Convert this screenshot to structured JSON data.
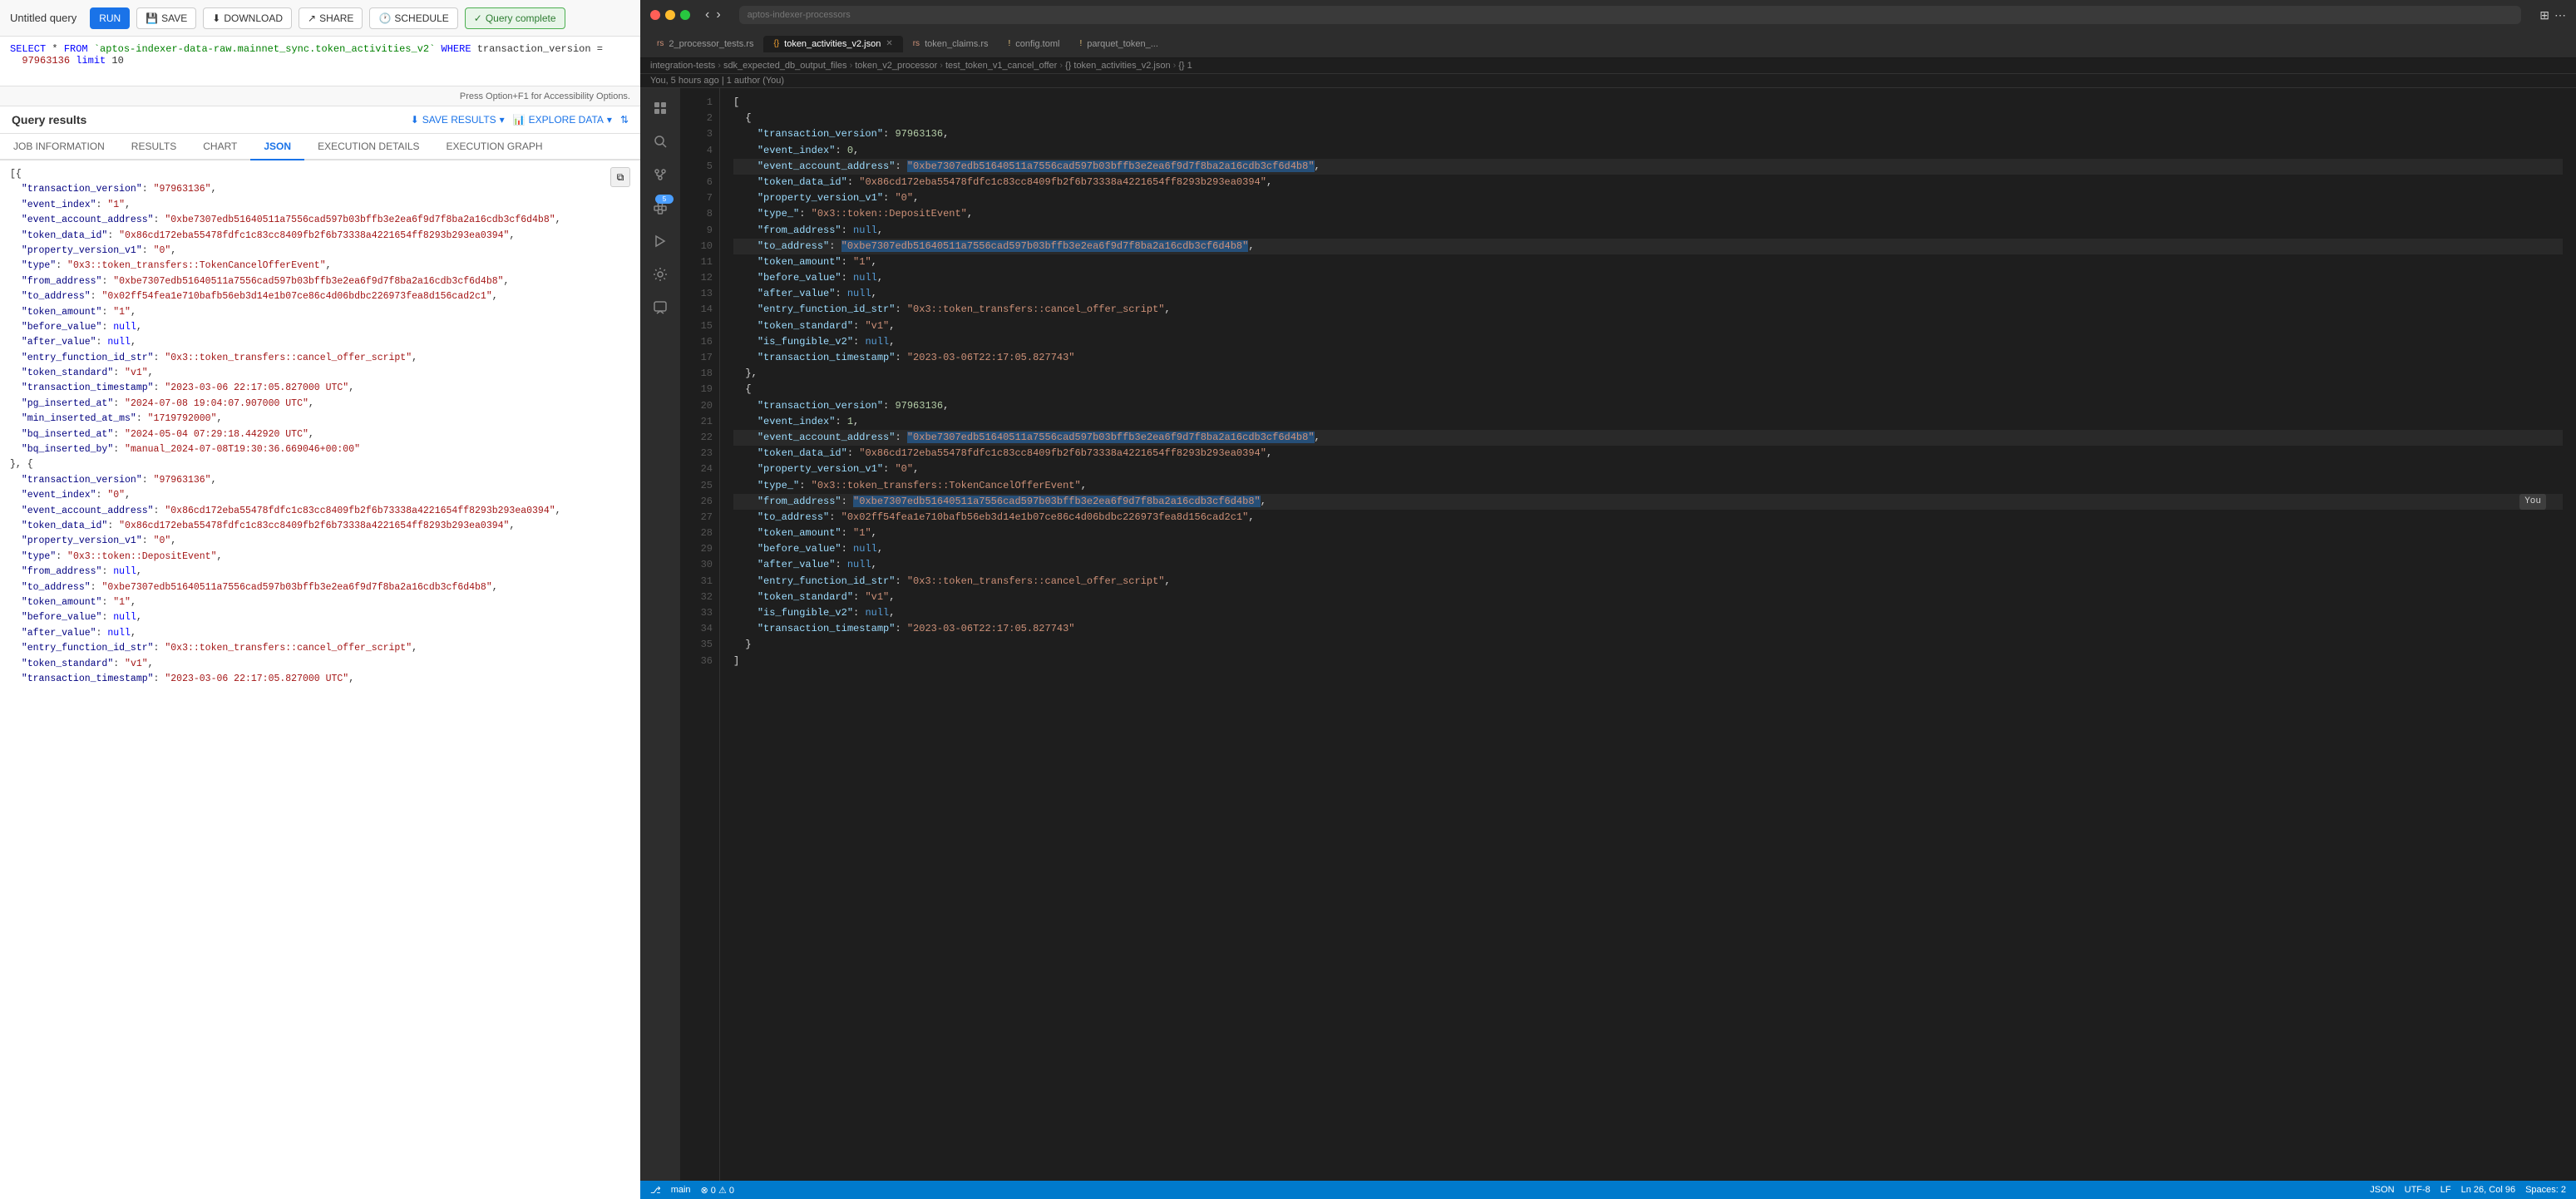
{
  "leftPanel": {
    "toolbar": {
      "title": "Untitled query",
      "runLabel": "RUN",
      "saveLabel": "SAVE",
      "downloadLabel": "DOWNLOAD",
      "shareLabel": "SHARE",
      "scheduleLabel": "SCHEDULE",
      "queryCompleteLabel": "Query complete"
    },
    "query": {
      "line1": "SELECT * FROM `aptos-indexer-data-raw.mainnet_sync.token_activities_v2` WHERE transaction_version =",
      "line2": "  97963136 limit 10"
    },
    "accessibility": "Press Option+F1 for Accessibility Options.",
    "resultsTitle": "Query results",
    "saveResultsLabel": "SAVE RESULTS",
    "exploreDataLabel": "EXPLORE DATA",
    "tabs": [
      {
        "label": "JOB INFORMATION",
        "active": false
      },
      {
        "label": "RESULTS",
        "active": false
      },
      {
        "label": "CHART",
        "active": false
      },
      {
        "label": "JSON",
        "active": true
      },
      {
        "label": "EXECUTION DETAILS",
        "active": false
      },
      {
        "label": "EXECUTION GRAPH",
        "active": false
      }
    ],
    "jsonData": [
      "[ {",
      "  \"transaction_version\": \"97963136\",",
      "  \"event_index\": \"1\",",
      "  \"event_account_address\": \"0xbe7307edb51640511a7556cad597b03bffb3e2ea6f9d7f8ba2a16cdb3cf6d4b8\",",
      "  \"token_data_id\": \"0x86cd172eba55478fdfc1c83cc8409fb2f6b73338a4221654ff8293b293ea0394\",",
      "  \"property_version_v1\": \"0\",",
      "  \"type\": \"0x3::token_transfers::TokenCancelOfferEvent\",",
      "  \"from_address\": \"0xbe7307edb51640511a7556cad597b03bffb3e2ea6f9d7f8ba2a16cdb3cf6d4b8\",",
      "  \"to_address\": \"0x02ff54fea1e710bafb56eb3d14e1b07ce86c4d06bdbc226973fea8d156cad2c1\",",
      "  \"token_amount\": \"1\",",
      "  \"before_value\": null,",
      "  \"after_value\": null,",
      "  \"entry_function_id_str\": \"0x3::token_transfers::cancel_offer_script\",",
      "  \"token_standard\": \"v1\",",
      "  \"transaction_timestamp\": \"2023-03-06 22:17:05.827000 UTC\",",
      "  \"pg_inserted_at\": \"2024-07-08 19:04:07.907000 UTC\",",
      "  \"min_inserted_at_ms\": \"1719792000\",",
      "  \"bq_inserted_at\": \"2024-05-04 07:29:18.442920 UTC\",",
      "  \"bq_inserted_by\": \"manual_2024-07-08T19:30:36.669046+00:00\"",
      "}, {",
      "  \"transaction_version\": \"97963136\",",
      "  \"event_index\": \"0\",",
      "  \"event_account_address\": \"0x86cd172eba55478fdfc1c83cc8409fb2f6b73338a4221654ff8293b293ea0394\",",
      "  \"token_data_id\": \"0x86cd172eba55478fdfc1c83cc8409fb2f6b73338a4221654ff8293b293ea0394\",",
      "  \"property_version_v1\": \"0\",",
      "  \"type\": \"0x3::token::DepositEvent\",",
      "  \"from_address\": null,",
      "  \"to_address\": \"0xbe7307edb51640511a7556cad597b03bffb3e2ea6f9d7f8ba2a16cdb3cf6d4b8\",",
      "  \"token_amount\": \"1\",",
      "  \"before_value\": null,",
      "  \"after_value\": null,",
      "  \"entry_function_id_str\": \"0x3::token_transfers::cancel_offer_script\",",
      "  \"token_standard\": \"v1\",",
      "  \"transaction_timestamp\": \"2023-03-06 22:17:05.827000 UTC\","
    ]
  },
  "rightPanel": {
    "searchPlaceholder": "aptos-indexer-processors",
    "tabs": [
      {
        "label": "2_processor_tests.rs",
        "type": "rs",
        "active": false,
        "modified": false
      },
      {
        "label": "token_activities_v2.json",
        "type": "json",
        "active": true,
        "modified": false
      },
      {
        "label": "token_claims.rs",
        "type": "rs",
        "active": false,
        "modified": false
      },
      {
        "label": "config.toml",
        "type": "toml",
        "active": false,
        "modified": true
      },
      {
        "label": "parquet_token_...",
        "type": "rs",
        "active": false,
        "modified": true
      }
    ],
    "breadcrumb": [
      "integration-tests",
      "sdk_expected_db_output_files",
      "token_v2_processor",
      "test_token_v1_cancel_offer",
      "{} token_activities_v2.json",
      "{} 1"
    ],
    "gitInfo": "You, 5 hours ago | 1 author (You)",
    "sidebarIcons": [
      "search",
      "git",
      "debug",
      "extensions",
      "account",
      "settings",
      "chat"
    ],
    "codeLines": [
      {
        "num": 1,
        "content": "["
      },
      {
        "num": 2,
        "content": "  {"
      },
      {
        "num": 3,
        "content": "    \"transaction_version\": 97963136,",
        "keys": [
          "transaction_version"
        ],
        "vals": [
          97963136
        ]
      },
      {
        "num": 4,
        "content": "    \"event_index\": 0,",
        "keys": [
          "event_index"
        ],
        "vals": [
          0
        ]
      },
      {
        "num": 5,
        "content": "    \"event_account_address\": \"0xbe7307edb51640511a7556cad597b03bffb3e2ea6f9d7f8ba2a16cdb3cf6d4b8\",",
        "highlight": true
      },
      {
        "num": 6,
        "content": "    \"token_data_id\": \"0x86cd172eba55478fdfc1c83cc8409fb2f6b73338a4221654ff8293b293ea0394\","
      },
      {
        "num": 7,
        "content": "    \"property_version_v1\": \"0\","
      },
      {
        "num": 8,
        "content": "    \"type_\": \"0x3::token::DepositEvent\","
      },
      {
        "num": 9,
        "content": "    \"from_address\": null,"
      },
      {
        "num": 10,
        "content": "    \"to_address\": \"0xbe7307edb51640511a7556cad597b03bffb3e2ea6f9d7f8ba2a16cdb3cf6d4b8\",",
        "highlight": true
      },
      {
        "num": 11,
        "content": "    \"token_amount\": \"1\","
      },
      {
        "num": 12,
        "content": "    \"before_value\": null,"
      },
      {
        "num": 13,
        "content": "    \"after_value\": null,"
      },
      {
        "num": 14,
        "content": "    \"entry_function_id_str\": \"0x3::token_transfers::cancel_offer_script\","
      },
      {
        "num": 15,
        "content": "    \"token_standard\": \"v1\","
      },
      {
        "num": 16,
        "content": "    \"is_fungible_v2\": null,"
      },
      {
        "num": 17,
        "content": "    \"transaction_timestamp\": \"2023-03-06T22:17:05.827743\""
      },
      {
        "num": 18,
        "content": "  },"
      },
      {
        "num": 19,
        "content": "  {"
      },
      {
        "num": 20,
        "content": "    \"transaction_version\": 97963136,"
      },
      {
        "num": 21,
        "content": "    \"event_index\": 1,"
      },
      {
        "num": 22,
        "content": "    \"event_account_address\": \"0xbe7307edb51640511a7556cad597b03bffb3e2ea6f9d7f8ba2a16cdb3cf6d4b8\",",
        "highlight": true
      },
      {
        "num": 23,
        "content": "    \"token_data_id\": \"0x86cd172eba55478fdfc1c83cc8409fb2f6b73338a4221654ff8293b293ea0394\","
      },
      {
        "num": 24,
        "content": "    \"property_version_v1\": \"0\","
      },
      {
        "num": 25,
        "content": "    \"type_\": \"0x3::token_transfers::TokenCancelOfferEvent\","
      },
      {
        "num": 26,
        "content": "    \"from_address\": \"0xbe7307edb51640511a7556cad597b03bffb3e2ea6f9d7f8ba2a16cdb3cf6d4b8\",",
        "highlight": true
      },
      {
        "num": 27,
        "content": "    \"to_address\": \"0x02ff54fea1e710bafb56eb3d14e1b07ce86c4d06bdbc226973fea8d156cad2c1\","
      },
      {
        "num": 28,
        "content": "    \"token_amount\": \"1\","
      },
      {
        "num": 29,
        "content": "    \"before_value\": null,"
      },
      {
        "num": 30,
        "content": "    \"after_value\": null,"
      },
      {
        "num": 31,
        "content": "    \"entry_function_id_str\": \"0x3::token_transfers::cancel_offer_script\","
      },
      {
        "num": 32,
        "content": "    \"token_standard\": \"v1\","
      },
      {
        "num": 33,
        "content": "    \"is_fungible_v2\": null,"
      },
      {
        "num": 34,
        "content": "    \"transaction_timestamp\": \"2023-03-06T22:17:05.827743\""
      },
      {
        "num": 35,
        "content": "  }"
      },
      {
        "num": 36,
        "content": "]"
      }
    ]
  }
}
